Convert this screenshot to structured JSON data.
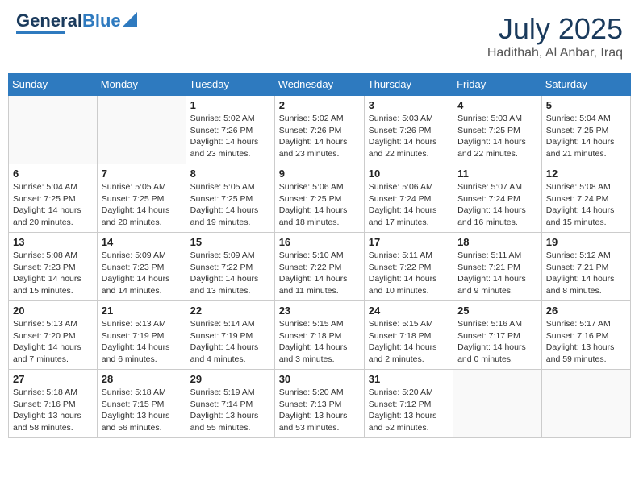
{
  "header": {
    "logo_general": "General",
    "logo_blue": "Blue",
    "month": "July 2025",
    "location": "Hadithah, Al Anbar, Iraq"
  },
  "weekdays": [
    "Sunday",
    "Monday",
    "Tuesday",
    "Wednesday",
    "Thursday",
    "Friday",
    "Saturday"
  ],
  "weeks": [
    [
      {
        "day": "",
        "sunrise": "",
        "sunset": "",
        "daylight": ""
      },
      {
        "day": "",
        "sunrise": "",
        "sunset": "",
        "daylight": ""
      },
      {
        "day": "1",
        "sunrise": "Sunrise: 5:02 AM",
        "sunset": "Sunset: 7:26 PM",
        "daylight": "Daylight: 14 hours and 23 minutes."
      },
      {
        "day": "2",
        "sunrise": "Sunrise: 5:02 AM",
        "sunset": "Sunset: 7:26 PM",
        "daylight": "Daylight: 14 hours and 23 minutes."
      },
      {
        "day": "3",
        "sunrise": "Sunrise: 5:03 AM",
        "sunset": "Sunset: 7:26 PM",
        "daylight": "Daylight: 14 hours and 22 minutes."
      },
      {
        "day": "4",
        "sunrise": "Sunrise: 5:03 AM",
        "sunset": "Sunset: 7:25 PM",
        "daylight": "Daylight: 14 hours and 22 minutes."
      },
      {
        "day": "5",
        "sunrise": "Sunrise: 5:04 AM",
        "sunset": "Sunset: 7:25 PM",
        "daylight": "Daylight: 14 hours and 21 minutes."
      }
    ],
    [
      {
        "day": "6",
        "sunrise": "Sunrise: 5:04 AM",
        "sunset": "Sunset: 7:25 PM",
        "daylight": "Daylight: 14 hours and 20 minutes."
      },
      {
        "day": "7",
        "sunrise": "Sunrise: 5:05 AM",
        "sunset": "Sunset: 7:25 PM",
        "daylight": "Daylight: 14 hours and 20 minutes."
      },
      {
        "day": "8",
        "sunrise": "Sunrise: 5:05 AM",
        "sunset": "Sunset: 7:25 PM",
        "daylight": "Daylight: 14 hours and 19 minutes."
      },
      {
        "day": "9",
        "sunrise": "Sunrise: 5:06 AM",
        "sunset": "Sunset: 7:25 PM",
        "daylight": "Daylight: 14 hours and 18 minutes."
      },
      {
        "day": "10",
        "sunrise": "Sunrise: 5:06 AM",
        "sunset": "Sunset: 7:24 PM",
        "daylight": "Daylight: 14 hours and 17 minutes."
      },
      {
        "day": "11",
        "sunrise": "Sunrise: 5:07 AM",
        "sunset": "Sunset: 7:24 PM",
        "daylight": "Daylight: 14 hours and 16 minutes."
      },
      {
        "day": "12",
        "sunrise": "Sunrise: 5:08 AM",
        "sunset": "Sunset: 7:24 PM",
        "daylight": "Daylight: 14 hours and 15 minutes."
      }
    ],
    [
      {
        "day": "13",
        "sunrise": "Sunrise: 5:08 AM",
        "sunset": "Sunset: 7:23 PM",
        "daylight": "Daylight: 14 hours and 15 minutes."
      },
      {
        "day": "14",
        "sunrise": "Sunrise: 5:09 AM",
        "sunset": "Sunset: 7:23 PM",
        "daylight": "Daylight: 14 hours and 14 minutes."
      },
      {
        "day": "15",
        "sunrise": "Sunrise: 5:09 AM",
        "sunset": "Sunset: 7:22 PM",
        "daylight": "Daylight: 14 hours and 13 minutes."
      },
      {
        "day": "16",
        "sunrise": "Sunrise: 5:10 AM",
        "sunset": "Sunset: 7:22 PM",
        "daylight": "Daylight: 14 hours and 11 minutes."
      },
      {
        "day": "17",
        "sunrise": "Sunrise: 5:11 AM",
        "sunset": "Sunset: 7:22 PM",
        "daylight": "Daylight: 14 hours and 10 minutes."
      },
      {
        "day": "18",
        "sunrise": "Sunrise: 5:11 AM",
        "sunset": "Sunset: 7:21 PM",
        "daylight": "Daylight: 14 hours and 9 minutes."
      },
      {
        "day": "19",
        "sunrise": "Sunrise: 5:12 AM",
        "sunset": "Sunset: 7:21 PM",
        "daylight": "Daylight: 14 hours and 8 minutes."
      }
    ],
    [
      {
        "day": "20",
        "sunrise": "Sunrise: 5:13 AM",
        "sunset": "Sunset: 7:20 PM",
        "daylight": "Daylight: 14 hours and 7 minutes."
      },
      {
        "day": "21",
        "sunrise": "Sunrise: 5:13 AM",
        "sunset": "Sunset: 7:19 PM",
        "daylight": "Daylight: 14 hours and 6 minutes."
      },
      {
        "day": "22",
        "sunrise": "Sunrise: 5:14 AM",
        "sunset": "Sunset: 7:19 PM",
        "daylight": "Daylight: 14 hours and 4 minutes."
      },
      {
        "day": "23",
        "sunrise": "Sunrise: 5:15 AM",
        "sunset": "Sunset: 7:18 PM",
        "daylight": "Daylight: 14 hours and 3 minutes."
      },
      {
        "day": "24",
        "sunrise": "Sunrise: 5:15 AM",
        "sunset": "Sunset: 7:18 PM",
        "daylight": "Daylight: 14 hours and 2 minutes."
      },
      {
        "day": "25",
        "sunrise": "Sunrise: 5:16 AM",
        "sunset": "Sunset: 7:17 PM",
        "daylight": "Daylight: 14 hours and 0 minutes."
      },
      {
        "day": "26",
        "sunrise": "Sunrise: 5:17 AM",
        "sunset": "Sunset: 7:16 PM",
        "daylight": "Daylight: 13 hours and 59 minutes."
      }
    ],
    [
      {
        "day": "27",
        "sunrise": "Sunrise: 5:18 AM",
        "sunset": "Sunset: 7:16 PM",
        "daylight": "Daylight: 13 hours and 58 minutes."
      },
      {
        "day": "28",
        "sunrise": "Sunrise: 5:18 AM",
        "sunset": "Sunset: 7:15 PM",
        "daylight": "Daylight: 13 hours and 56 minutes."
      },
      {
        "day": "29",
        "sunrise": "Sunrise: 5:19 AM",
        "sunset": "Sunset: 7:14 PM",
        "daylight": "Daylight: 13 hours and 55 minutes."
      },
      {
        "day": "30",
        "sunrise": "Sunrise: 5:20 AM",
        "sunset": "Sunset: 7:13 PM",
        "daylight": "Daylight: 13 hours and 53 minutes."
      },
      {
        "day": "31",
        "sunrise": "Sunrise: 5:20 AM",
        "sunset": "Sunset: 7:12 PM",
        "daylight": "Daylight: 13 hours and 52 minutes."
      },
      {
        "day": "",
        "sunrise": "",
        "sunset": "",
        "daylight": ""
      },
      {
        "day": "",
        "sunrise": "",
        "sunset": "",
        "daylight": ""
      }
    ]
  ]
}
